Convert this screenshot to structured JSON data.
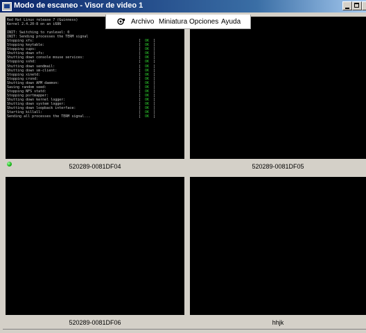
{
  "window": {
    "title": "Modo de escaneo - Visor de video 1",
    "close_glyph": "x"
  },
  "menu": {
    "icon": "camera-icon",
    "items": [
      "Archivo",
      "Miniatura",
      "Opciones",
      "Ayuda"
    ]
  },
  "tiles": [
    {
      "caption": "520289-0081DF04",
      "status": "connected"
    },
    {
      "caption": "520289-0081DF05"
    },
    {
      "caption": "520289-0081DF06"
    },
    {
      "caption": "hhjk"
    }
  ],
  "terminal": {
    "header": [
      "Red Hat Linux release 7 (Guinness)",
      "Kernel 2.4.20-8 on an i686",
      "",
      "INIT: Switching to runlevel: 0",
      "INIT: Sending processes the TERM signal"
    ],
    "lines": [
      {
        "text": "Stopping xfs:",
        "status": "OK"
      },
      {
        "text": "Stopping keytable:",
        "status": "OK"
      },
      {
        "text": "Stopping cups:",
        "status": "OK"
      },
      {
        "text": "Shutting down xfs:",
        "status": "OK"
      },
      {
        "text": "Shutting down console mouse services:",
        "status": "OK"
      },
      {
        "text": "Stopping sshd:",
        "status": "OK"
      },
      {
        "text": "Shutting down sendmail:",
        "status": "OK"
      },
      {
        "text": "Shutting down sm-client:",
        "status": "OK"
      },
      {
        "text": "Stopping xinetd:",
        "status": "OK"
      },
      {
        "text": "Stopping crond:",
        "status": "OK"
      },
      {
        "text": "Shutting down APM daemon:",
        "status": "OK"
      },
      {
        "text": "Saving random seed:",
        "status": "OK"
      },
      {
        "text": "Stopping NFS statd:",
        "status": "OK"
      },
      {
        "text": "Stopping portmapper:",
        "status": "OK"
      },
      {
        "text": "Shutting down kernel logger:",
        "status": "OK"
      },
      {
        "text": "Shutting down system logger:",
        "status": "OK"
      },
      {
        "text": "Shutting down loopback interface:",
        "status": "OK"
      },
      {
        "text": "Starting killall:",
        "status": "OK"
      },
      {
        "text": "Sending all processes the TERM signal...",
        "status": "OK"
      }
    ]
  },
  "colors": {
    "status_led": "#17b517",
    "ok_text": "#2fd22f",
    "titlebar_start": "#0a246a",
    "titlebar_end": "#a6caf0"
  }
}
